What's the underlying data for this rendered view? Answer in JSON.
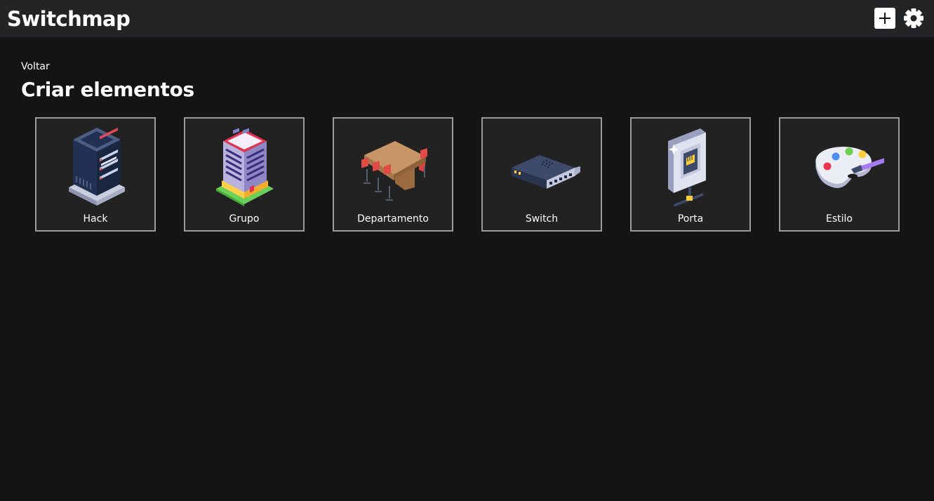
{
  "header": {
    "app_title": "Switchmap",
    "add_icon": "plus-icon",
    "settings_icon": "gear-icon"
  },
  "main": {
    "back_label": "Voltar",
    "title": "Criar elementos",
    "tiles": [
      {
        "label": "Hack",
        "icon": "server-rack-icon"
      },
      {
        "label": "Grupo",
        "icon": "building-icon"
      },
      {
        "label": "Departamento",
        "icon": "conference-table-icon"
      },
      {
        "label": "Switch",
        "icon": "network-switch-icon"
      },
      {
        "label": "Porta",
        "icon": "ethernet-port-icon"
      },
      {
        "label": "Estilo",
        "icon": "paint-palette-icon"
      }
    ]
  },
  "colors": {
    "background": "#141414",
    "topbar": "#232425",
    "tile_background": "#222222",
    "tile_border": "#9a9a9a"
  }
}
